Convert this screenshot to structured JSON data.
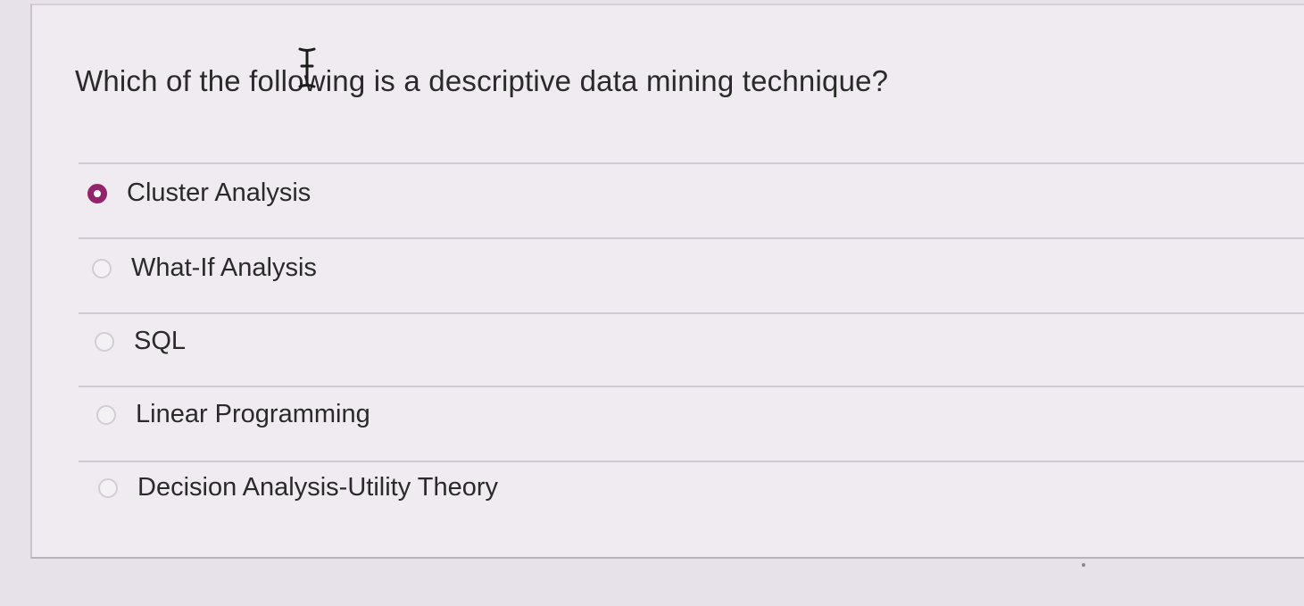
{
  "question": {
    "text": "Which of the following is a descriptive data mining technique?"
  },
  "options": [
    {
      "label": "Cluster Analysis",
      "selected": true
    },
    {
      "label": "What-If Analysis",
      "selected": false
    },
    {
      "label": "SQL",
      "selected": false
    },
    {
      "label": "Linear Programming",
      "selected": false
    },
    {
      "label": "Decision Analysis-Utility Theory",
      "selected": false
    }
  ],
  "colors": {
    "selected_radio": "#93246b",
    "background": "#e7e1ea"
  },
  "icons": {
    "cursor": "text-cursor-icon"
  }
}
